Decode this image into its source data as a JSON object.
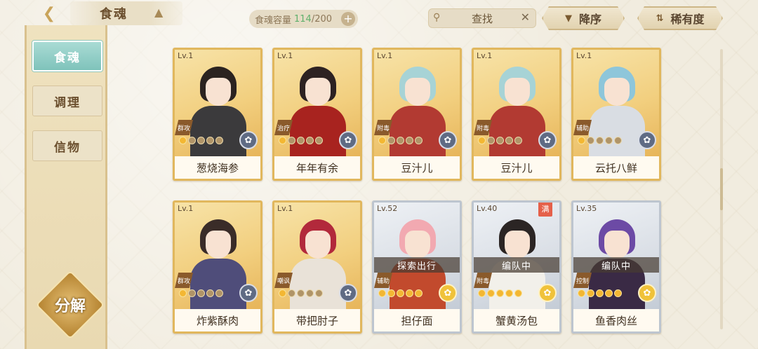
{
  "header": {
    "title": "食魂",
    "capacity_label": "食魂容量",
    "capacity_current": "114",
    "capacity_max": "/200",
    "search_label": "查找",
    "sort_order_label": "降序",
    "sort_rarity_label": "稀有度"
  },
  "sidebar": {
    "items": [
      {
        "label": "食魂",
        "active": true
      },
      {
        "label": "调理",
        "active": false
      },
      {
        "label": "信物",
        "active": false
      }
    ],
    "decompose_label": "分解"
  },
  "cards": [
    {
      "level": "Lv.1",
      "name": "葱烧海参",
      "role": "群攻",
      "stars": 1,
      "element": "dark",
      "frame": "gold",
      "status": "",
      "hair": "#2b2320",
      "outfit": "#3b3a3c"
    },
    {
      "level": "Lv.1",
      "name": "年年有余",
      "role": "治疗",
      "stars": 1,
      "element": "dark",
      "frame": "gold",
      "status": "",
      "hair": "#2d2222",
      "outfit": "#a8231f"
    },
    {
      "level": "Lv.1",
      "name": "豆汁儿",
      "role": "附毒",
      "stars": 1,
      "element": "dark",
      "frame": "gold",
      "status": "",
      "hair": "#a7d3d6",
      "outfit": "#b23a32"
    },
    {
      "level": "Lv.1",
      "name": "豆汁儿",
      "role": "附毒",
      "stars": 1,
      "element": "dark",
      "frame": "gold",
      "status": "",
      "hair": "#a7d3d6",
      "outfit": "#b23a32"
    },
    {
      "level": "Lv.1",
      "name": "云托八鲜",
      "role": "辅助",
      "stars": 1,
      "element": "dark",
      "frame": "gold",
      "status": "",
      "hair": "#8ec6da",
      "outfit": "#d9dde3"
    },
    {
      "level": "Lv.1",
      "name": "炸紫酥肉",
      "role": "群攻",
      "stars": 1,
      "element": "dark",
      "frame": "gold",
      "status": "",
      "hair": "#3a2c28",
      "outfit": "#4f4d7a"
    },
    {
      "level": "Lv.1",
      "name": "带把肘子",
      "role": "嘲讽",
      "stars": 1,
      "element": "dark",
      "frame": "gold",
      "status": "",
      "hair": "#b2293b",
      "outfit": "#e9e2d8"
    },
    {
      "level": "Lv.52",
      "name": "担仔面",
      "role": "辅助",
      "stars": 5,
      "element": "gold",
      "frame": "silver",
      "status": "探索出行",
      "hair": "#f2a9b1",
      "outfit": "#c24a2d"
    },
    {
      "level": "Lv.40",
      "name": "蟹黄汤包",
      "role": "附毒",
      "stars": 5,
      "element": "gold",
      "frame": "silver",
      "status": "编队中",
      "hair": "#2b2524",
      "outfit": "#f2f0ea",
      "tag": "满"
    },
    {
      "level": "Lv.35",
      "name": "鱼香肉丝",
      "role": "控制",
      "stars": 5,
      "element": "gold",
      "frame": "silver",
      "status": "编队中",
      "hair": "#6c4aa5",
      "outfit": "#3a2a45"
    }
  ],
  "colors": {
    "gold_frame": "#e1b75d",
    "silver_frame": "#bdc5cf",
    "active_tab": "#7fc3bb",
    "capacity_current": "#5fb06c"
  },
  "icons": {
    "back": "back-arrow-icon",
    "search": "magnifier-icon",
    "clear": "close-icon",
    "sort_order": "triangle-down-icon",
    "sort_rarity": "sort-arrows-icon",
    "add": "plus-icon"
  }
}
